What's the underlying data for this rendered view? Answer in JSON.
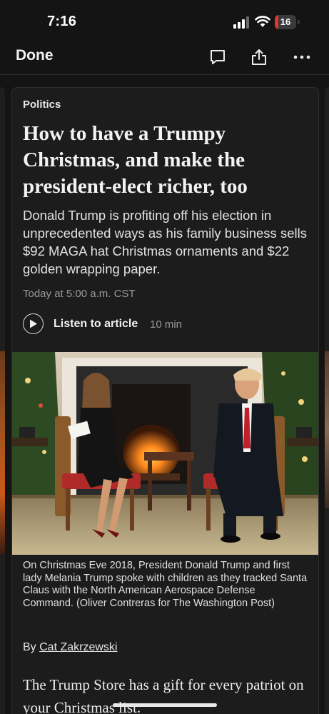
{
  "status_bar": {
    "time": "7:16",
    "battery_level": "16",
    "battery_fraction": 0.16,
    "battery_color": "#e5342c"
  },
  "nav": {
    "done_label": "Done",
    "icons": [
      "comment-icon",
      "share-icon",
      "more-icon"
    ]
  },
  "article": {
    "kicker": "Politics",
    "headline": "How to have a Trumpy Christmas, and make the president-elect richer, too",
    "dek": "Donald Trump is profiting off his election in unprecedented ways as his family business sells $92 MAGA hat Christmas ornaments and $22 golden wrapping paper.",
    "timestamp": "Today at 5:00 a.m. CST",
    "listen_label": "Listen to article",
    "listen_duration": "10 min",
    "photo_caption": "On Christmas Eve 2018, President Donald Trump and first lady Melania Trump spoke with children as they tracked Santa Claus with the North American Aerospace Defense Command. (Oliver Contreras for The Washington Post)",
    "byline_prefix": "By",
    "author": "Cat Zakrzewski",
    "body_first_line": "The Trump Store has a gift for every patriot on your Christmas list."
  }
}
